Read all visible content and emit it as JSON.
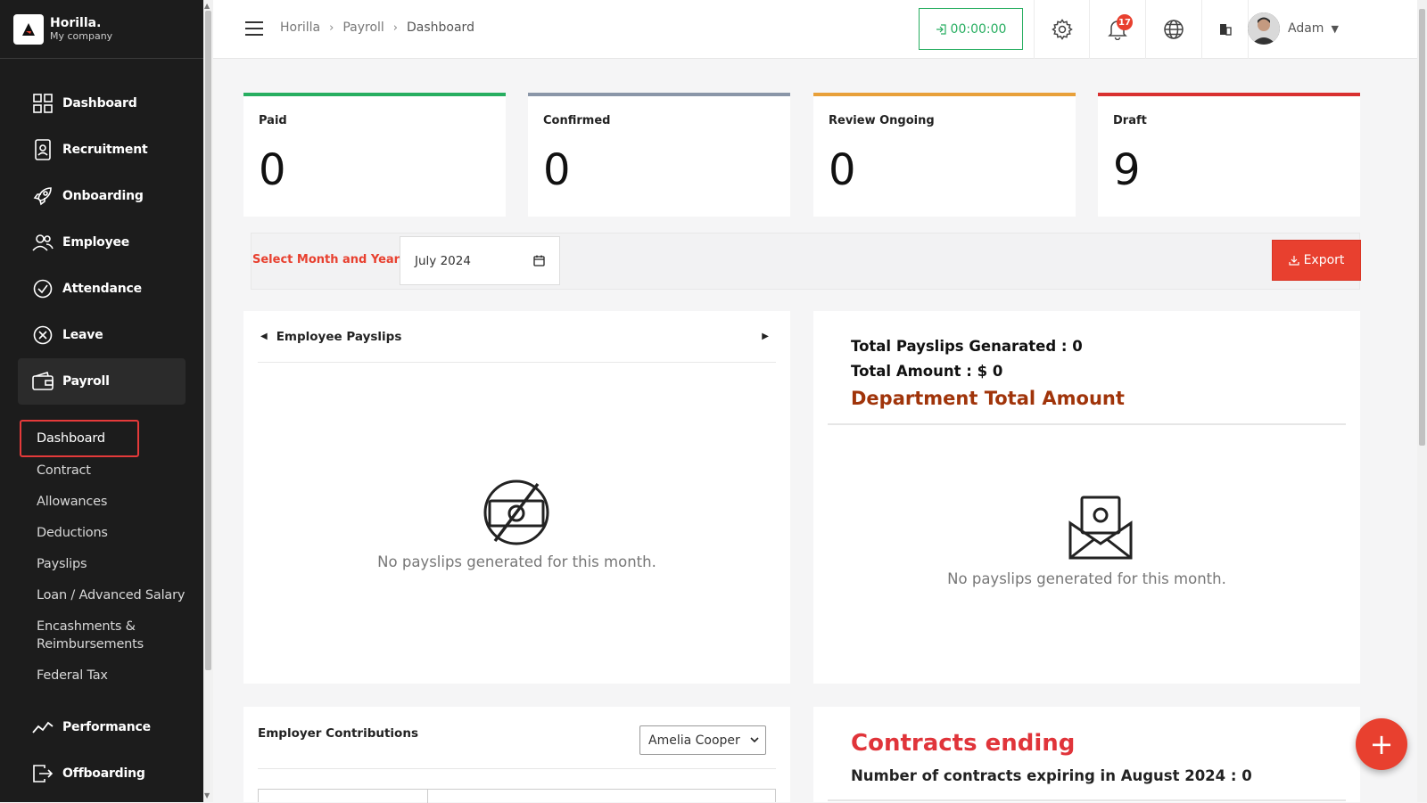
{
  "brand": {
    "name": "Horilla.",
    "company": "My company"
  },
  "nav": {
    "items": [
      {
        "label": "Dashboard",
        "icon": "grid-icon"
      },
      {
        "label": "Recruitment",
        "icon": "id-badge-icon"
      },
      {
        "label": "Onboarding",
        "icon": "rocket-icon"
      },
      {
        "label": "Employee",
        "icon": "people-icon"
      },
      {
        "label": "Attendance",
        "icon": "check-circle-icon"
      },
      {
        "label": "Leave",
        "icon": "x-circle-icon"
      },
      {
        "label": "Payroll",
        "icon": "wallet-icon"
      },
      {
        "label": "Performance",
        "icon": "trend-icon"
      },
      {
        "label": "Offboarding",
        "icon": "exit-icon"
      }
    ],
    "payroll_sub": [
      "Dashboard",
      "Contract",
      "Allowances",
      "Deductions",
      "Payslips",
      "Loan / Advanced Salary",
      "Encashments &",
      "Reimbursements",
      "Federal Tax"
    ]
  },
  "header": {
    "breadcrumb": [
      "Horilla",
      "Payroll",
      "Dashboard"
    ],
    "timer": "00:00:00",
    "notification_count": "17",
    "user_name": "Adam"
  },
  "status_cards": [
    {
      "label": "Paid",
      "value": "0",
      "color": "#27ae60"
    },
    {
      "label": "Confirmed",
      "value": "0",
      "color": "#8a96a8"
    },
    {
      "label": "Review Ongoing",
      "value": "0",
      "color": "#e8a03a"
    },
    {
      "label": "Draft",
      "value": "9",
      "color": "#d93030"
    }
  ],
  "filter": {
    "label": "Select Month and Year:",
    "value": "July 2024",
    "export_label": "Export"
  },
  "payslips_panel": {
    "title": "Employee Payslips",
    "empty": "No payslips generated for this month."
  },
  "summary_panel": {
    "total_payslips": "Total Payslips Genarated : 0",
    "total_amount": "Total Amount : $ 0",
    "dept_title": "Department Total Amount",
    "empty": "No payslips generated for this month."
  },
  "contributions_panel": {
    "title": "Employer Contributions",
    "selected_employee": "Amelia Cooper"
  },
  "contracts_panel": {
    "title": "Contracts ending",
    "subtitle": "Number of contracts expiring in August 2024 : 0"
  },
  "fab_label": "+"
}
